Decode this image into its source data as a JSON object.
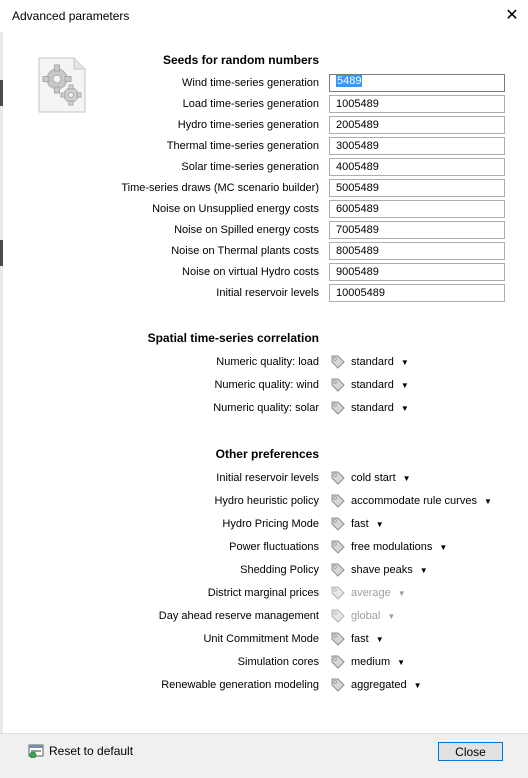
{
  "window": {
    "title": "Advanced parameters",
    "close_glyph": "✕"
  },
  "seeds": {
    "title": "Seeds for random numbers",
    "rows": [
      {
        "label": "Wind time-series generation",
        "value": "5489"
      },
      {
        "label": "Load time-series generation",
        "value": "1005489"
      },
      {
        "label": "Hydro time-series generation",
        "value": "2005489"
      },
      {
        "label": "Thermal time-series generation",
        "value": "3005489"
      },
      {
        "label": "Solar time-series generation",
        "value": "4005489"
      },
      {
        "label": "Time-series draws (MC scenario builder)",
        "value": "5005489"
      },
      {
        "label": "Noise on Unsupplied energy costs",
        "value": "6005489"
      },
      {
        "label": "Noise on Spilled energy costs",
        "value": "7005489"
      },
      {
        "label": "Noise on Thermal plants costs",
        "value": "8005489"
      },
      {
        "label": "Noise on virtual Hydro costs",
        "value": "9005489"
      },
      {
        "label": "Initial reservoir levels",
        "value": "10005489"
      }
    ]
  },
  "spatial": {
    "title": "Spatial time-series correlation",
    "rows": [
      {
        "label": "Numeric quality: load",
        "value": "standard"
      },
      {
        "label": "Numeric quality: wind",
        "value": "standard"
      },
      {
        "label": "Numeric quality: solar",
        "value": "standard"
      }
    ]
  },
  "other": {
    "title": "Other preferences",
    "rows": [
      {
        "label": "Initial reservoir levels",
        "value": "cold start"
      },
      {
        "label": "Hydro heuristic policy",
        "value": "accommodate rule curves"
      },
      {
        "label": "Hydro Pricing Mode",
        "value": "fast"
      },
      {
        "label": "Power fluctuations",
        "value": "free modulations"
      },
      {
        "label": "Shedding Policy",
        "value": "shave peaks"
      },
      {
        "label": "District marginal prices",
        "value": "average"
      },
      {
        "label": "Day ahead reserve management",
        "value": "global"
      },
      {
        "label": "Unit Commitment Mode",
        "value": "fast"
      },
      {
        "label": "Simulation cores",
        "value": "medium"
      },
      {
        "label": "Renewable generation modeling",
        "value": "aggregated"
      }
    ]
  },
  "footer": {
    "reset_label": "Reset to default",
    "close_label": "Close"
  },
  "icons": {
    "settings": "gears-document-icon",
    "tag": "tag-icon",
    "caret": "caret-down-icon",
    "reset": "reset-icon"
  },
  "colors": {
    "selection": "#3399ff",
    "primary_border": "#0078d7",
    "disabled_text": "#a0a0a0"
  }
}
